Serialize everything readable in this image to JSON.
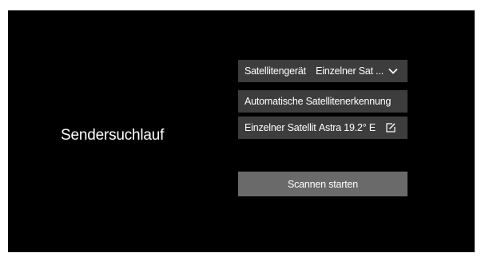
{
  "page": {
    "title": "Sendersuchlauf"
  },
  "settings": {
    "satellite_device": {
      "label": "Satellitengerät",
      "value": "Einzelner Sat ...",
      "icon": "chevron-down-icon"
    },
    "auto_detect": {
      "label": "Automatische Satellitenerkennung"
    },
    "single_satellite": {
      "label": "Einzelner Satellit",
      "value": "Astra 19.2° E",
      "icon": "edit-icon"
    }
  },
  "actions": {
    "scan_label": "Scannen starten"
  },
  "colors": {
    "background": "#000000",
    "row": "#3d3d3d",
    "button": "#6a6a6a",
    "text": "#ffffff"
  }
}
